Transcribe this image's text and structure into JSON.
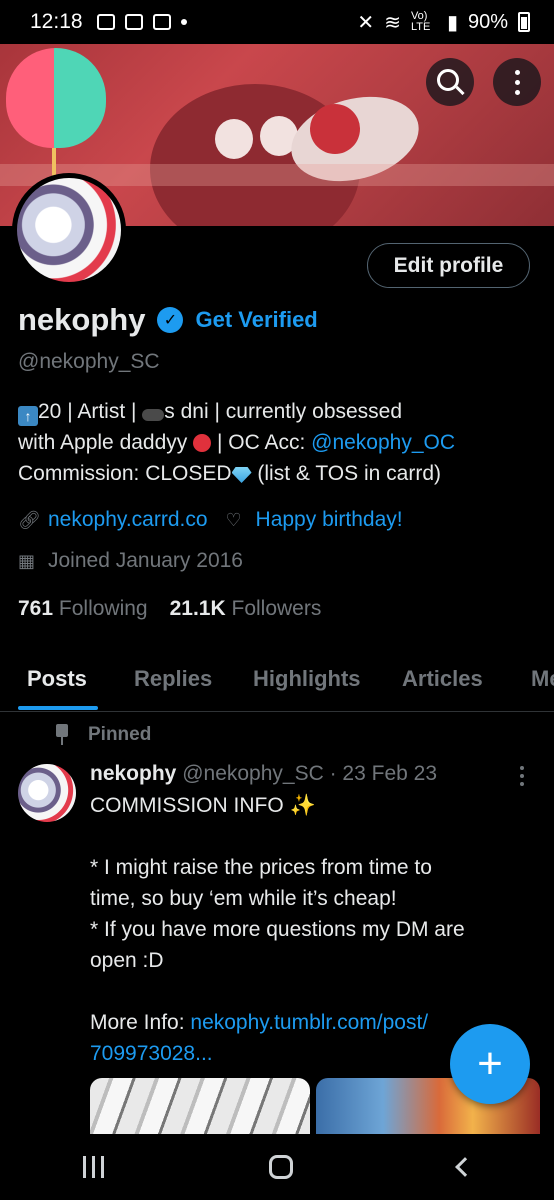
{
  "status_bar": {
    "time": "12:18",
    "network_label": "Vo) LTE",
    "battery": "90%"
  },
  "icons": {
    "search": "search-icon",
    "more": "more-vertical-icon",
    "verified": "verified-badge-icon",
    "link": "link-icon",
    "birthday": "balloon-icon",
    "calendar": "calendar-icon",
    "pin": "pin-icon",
    "compose": "plus-icon"
  },
  "profile": {
    "edit_label": "Edit profile",
    "name": "nekophy",
    "get_verified": "Get Verified",
    "handle": "@nekophy_SC",
    "bio": {
      "line1_a": "20 | Artist |",
      "line1_b": "s dni |  currently obsessed",
      "line2_a": "with Apple daddyy",
      "line2_b": " |  OC Acc: ",
      "oc_link": "@nekophy_OC",
      "line3_a": "Commission: CLOSED",
      "line3_b": " (list & TOS in carrd)"
    },
    "website": "nekophy.carrd.co",
    "birthday": "Happy birthday!",
    "joined": "Joined January 2016",
    "following_count": "761",
    "following_label": "Following",
    "followers_count": "21.1K",
    "followers_label": "Followers"
  },
  "tabs": [
    {
      "label": "Posts",
      "active": true
    },
    {
      "label": "Replies"
    },
    {
      "label": "Highlights"
    },
    {
      "label": "Articles"
    },
    {
      "label": "Me"
    }
  ],
  "post": {
    "pinned_label": "Pinned",
    "name": "nekophy",
    "meta": "@nekophy_SC · 23 Feb 23",
    "line1": "COMMISSION INFO ",
    "line1_emoji": "✨",
    "line2": "",
    "line3": "* I might raise the prices from time to",
    "line4": "time, so buy ‘em while it’s cheap!",
    "line5": "* If you have more questions my DM are",
    "line6": "open :D",
    "line7": "",
    "more_info_label": "More Info: ",
    "link_part1": "nekophy.tumblr.com/post/",
    "link_part2": "709973028..."
  },
  "fab_label": "+",
  "colors": {
    "accent": "#1d9bf0",
    "background": "#000000",
    "muted_text": "#71767b",
    "primary_text": "#e7e9ea"
  }
}
